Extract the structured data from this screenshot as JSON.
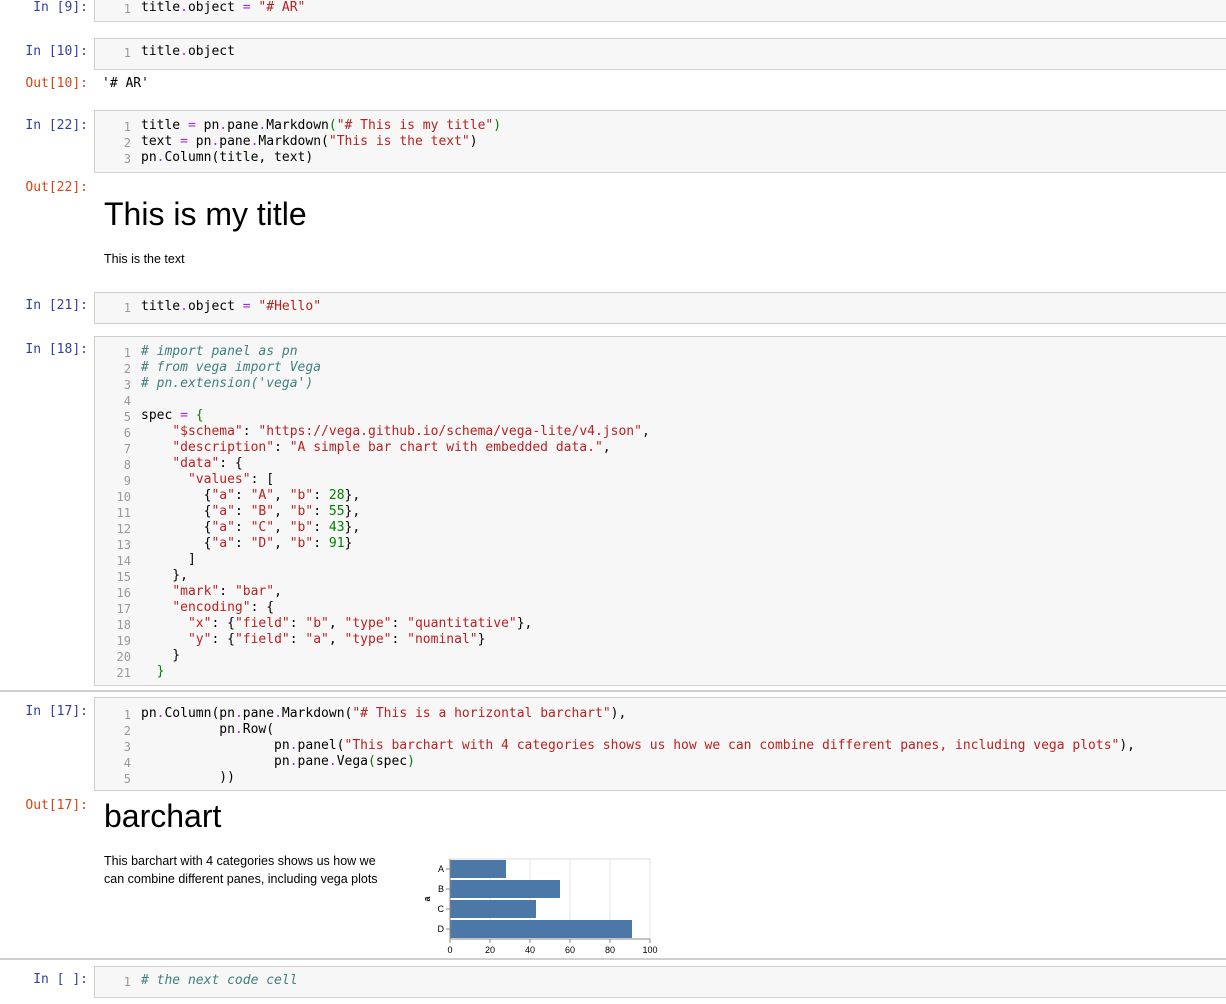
{
  "cells": {
    "c9": {
      "prompt": "In [9]:",
      "lines": [
        "1"
      ]
    },
    "c10": {
      "prompt": "In [10]:",
      "lines": [
        "1"
      ],
      "out_prompt": "Out[10]:",
      "output": "'# AR'"
    },
    "c22": {
      "prompt": "In [22]:",
      "lines": [
        "1",
        "2",
        "3"
      ],
      "out_prompt": "Out[22]:",
      "md_title": "This is my title",
      "md_text": "This is the text"
    },
    "c21": {
      "prompt": "In [21]:",
      "lines": [
        "1"
      ]
    },
    "c18": {
      "prompt": "In [18]:",
      "lines": [
        "1",
        "2",
        "3",
        "4",
        "5",
        "6",
        "7",
        "8",
        "9",
        "10",
        "11",
        "12",
        "13",
        "14",
        "15",
        "16",
        "17",
        "18",
        "19",
        "20",
        "21"
      ]
    },
    "c17": {
      "prompt": "In [17]:",
      "lines": [
        "1",
        "2",
        "3",
        "4",
        "5"
      ],
      "out_prompt": "Out[17]:",
      "md_title": "barchart",
      "md_text_1": "This barchart with 4 categories shows us how we",
      "md_text_2": "can combine different panes, including vega plots"
    },
    "cnext": {
      "prompt": "In [ ]:",
      "lines": [
        "1"
      ]
    }
  },
  "chart_data": {
    "type": "bar",
    "orientation": "horizontal",
    "categories": [
      "A",
      "B",
      "C",
      "D"
    ],
    "values": [
      28,
      55,
      43,
      91
    ],
    "ylabel": "a",
    "xlim": [
      0,
      100
    ],
    "xticks": [
      "0",
      "20",
      "40",
      "60",
      "80",
      "100"
    ],
    "bar_color": "#4c78a8",
    "grid": true
  },
  "colors": {
    "in_prompt": "#303F9F",
    "out_prompt": "#D84315"
  }
}
